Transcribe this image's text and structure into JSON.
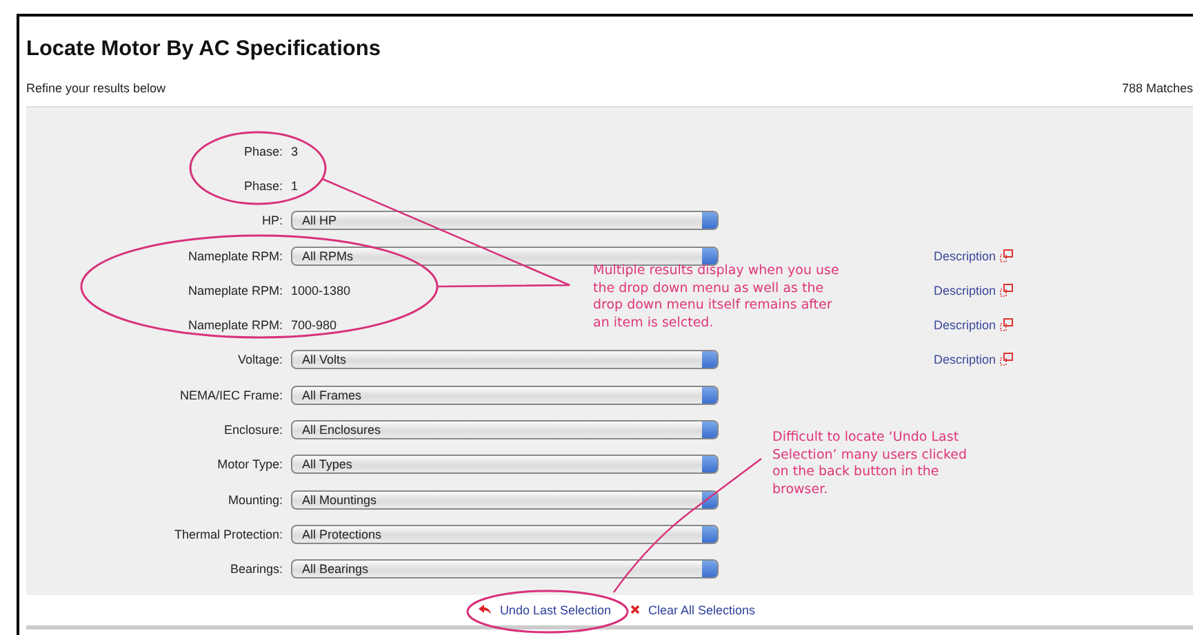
{
  "page": {
    "title": "Locate Motor By AC Specifications",
    "subtitle": "Refine your results below",
    "match_count": "788 Matches"
  },
  "filters": [
    {
      "kind": "value",
      "label": "Phase:",
      "value": "3",
      "description": false
    },
    {
      "kind": "value",
      "label": "Phase:",
      "value": "1",
      "description": false
    },
    {
      "kind": "select",
      "label": "HP:",
      "value": "All HP",
      "description": false
    },
    {
      "kind": "select",
      "label": "Nameplate RPM:",
      "value": "All RPMs",
      "description": true
    },
    {
      "kind": "value",
      "label": "Nameplate RPM:",
      "value": "1000-1380",
      "description": true
    },
    {
      "kind": "value",
      "label": "Nameplate RPM:",
      "value": "700-980",
      "description": true
    },
    {
      "kind": "select",
      "label": "Voltage:",
      "value": "All Volts",
      "description": true
    },
    {
      "kind": "select",
      "label": "NEMA/IEC Frame:",
      "value": "All Frames",
      "description": false
    },
    {
      "kind": "select",
      "label": "Enclosure:",
      "value": "All Enclosures",
      "description": false
    },
    {
      "kind": "select",
      "label": "Motor Type:",
      "value": "All Types",
      "description": false
    },
    {
      "kind": "select",
      "label": "Mounting:",
      "value": "All Mountings",
      "description": false
    },
    {
      "kind": "select",
      "label": "Thermal Protection:",
      "value": "All Protections",
      "description": false
    },
    {
      "kind": "select",
      "label": "Bearings:",
      "value": "All Bearings",
      "description": false
    }
  ],
  "description_link": [
    "Description",
    "Description",
    "Description",
    "Description"
  ],
  "actions": [
    {
      "kind": "undo",
      "label": "Undo Last Selection"
    },
    {
      "kind": "clear",
      "label": "Clear All Selections"
    }
  ],
  "annotations": [
    "Multiple results display when you use the drop down menu as well as the drop down menu itself remains after an item is selcted.",
    "Difficult to locate ‘Undo Last Selection’ many users clicked on the back button in the browser."
  ]
}
